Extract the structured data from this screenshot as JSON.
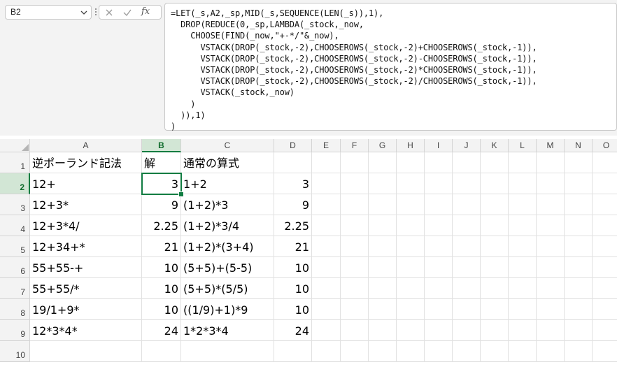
{
  "name_box": {
    "value": "B2"
  },
  "formula_bar": {
    "fx_label": "fx",
    "formula_lines": [
      "=LET(_s,A2,_sp,MID(_s,SEQUENCE(LEN(_s)),1),",
      "  DROP(REDUCE(0,_sp,LAMBDA(_stock,_now,",
      "    CHOOSE(FIND(_now,\"+-*/\"&_now),",
      "      VSTACK(DROP(_stock,-2),CHOOSEROWS(_stock,-2)+CHOOSEROWS(_stock,-1)),",
      "      VSTACK(DROP(_stock,-2),CHOOSEROWS(_stock,-2)-CHOOSEROWS(_stock,-1)),",
      "      VSTACK(DROP(_stock,-2),CHOOSEROWS(_stock,-2)*CHOOSEROWS(_stock,-1)),",
      "      VSTACK(DROP(_stock,-2),CHOOSEROWS(_stock,-2)/CHOOSEROWS(_stock,-1)),",
      "      VSTACK(_stock,_now)",
      "    )",
      "  )),1)",
      ")"
    ]
  },
  "columns": [
    "A",
    "B",
    "C",
    "D",
    "E",
    "F",
    "G",
    "H",
    "I",
    "J",
    "K",
    "L",
    "M",
    "N",
    "O"
  ],
  "selected_column": "B",
  "selected_row": "2",
  "row_numbers": [
    "1",
    "2",
    "3",
    "4",
    "5",
    "6",
    "7",
    "8",
    "9",
    "10"
  ],
  "rows": [
    {
      "a": "逆ポーランド記法",
      "b": "解",
      "c": "通常の算式",
      "d": ""
    },
    {
      "a": "12+",
      "b": "3",
      "c": "1+2",
      "d": "3"
    },
    {
      "a": "12+3*",
      "b": "9",
      "c": "(1+2)*3",
      "d": "9"
    },
    {
      "a": "12+3*4/",
      "b": "2.25",
      "c": "(1+2)*3/4",
      "d": "2.25"
    },
    {
      "a": "12+34+*",
      "b": "21",
      "c": "(1+2)*(3+4)",
      "d": "21"
    },
    {
      "a": "55+55-+",
      "b": "10",
      "c": "(5+5)+(5-5)",
      "d": "10"
    },
    {
      "a": "55+55/*",
      "b": "10",
      "c": "(5+5)*(5/5)",
      "d": "10"
    },
    {
      "a": "19/1+9*",
      "b": "10",
      "c": "((1/9)+1)*9",
      "d": "10"
    },
    {
      "a": "12*3*4*",
      "b": "24",
      "c": "1*2*3*4",
      "d": "24"
    },
    {
      "a": "",
      "b": "",
      "c": "",
      "d": ""
    }
  ],
  "colors": {
    "accent": "#107c41",
    "header_bg": "#f3f3f3",
    "selected_header_bg": "#d2e6d5"
  }
}
